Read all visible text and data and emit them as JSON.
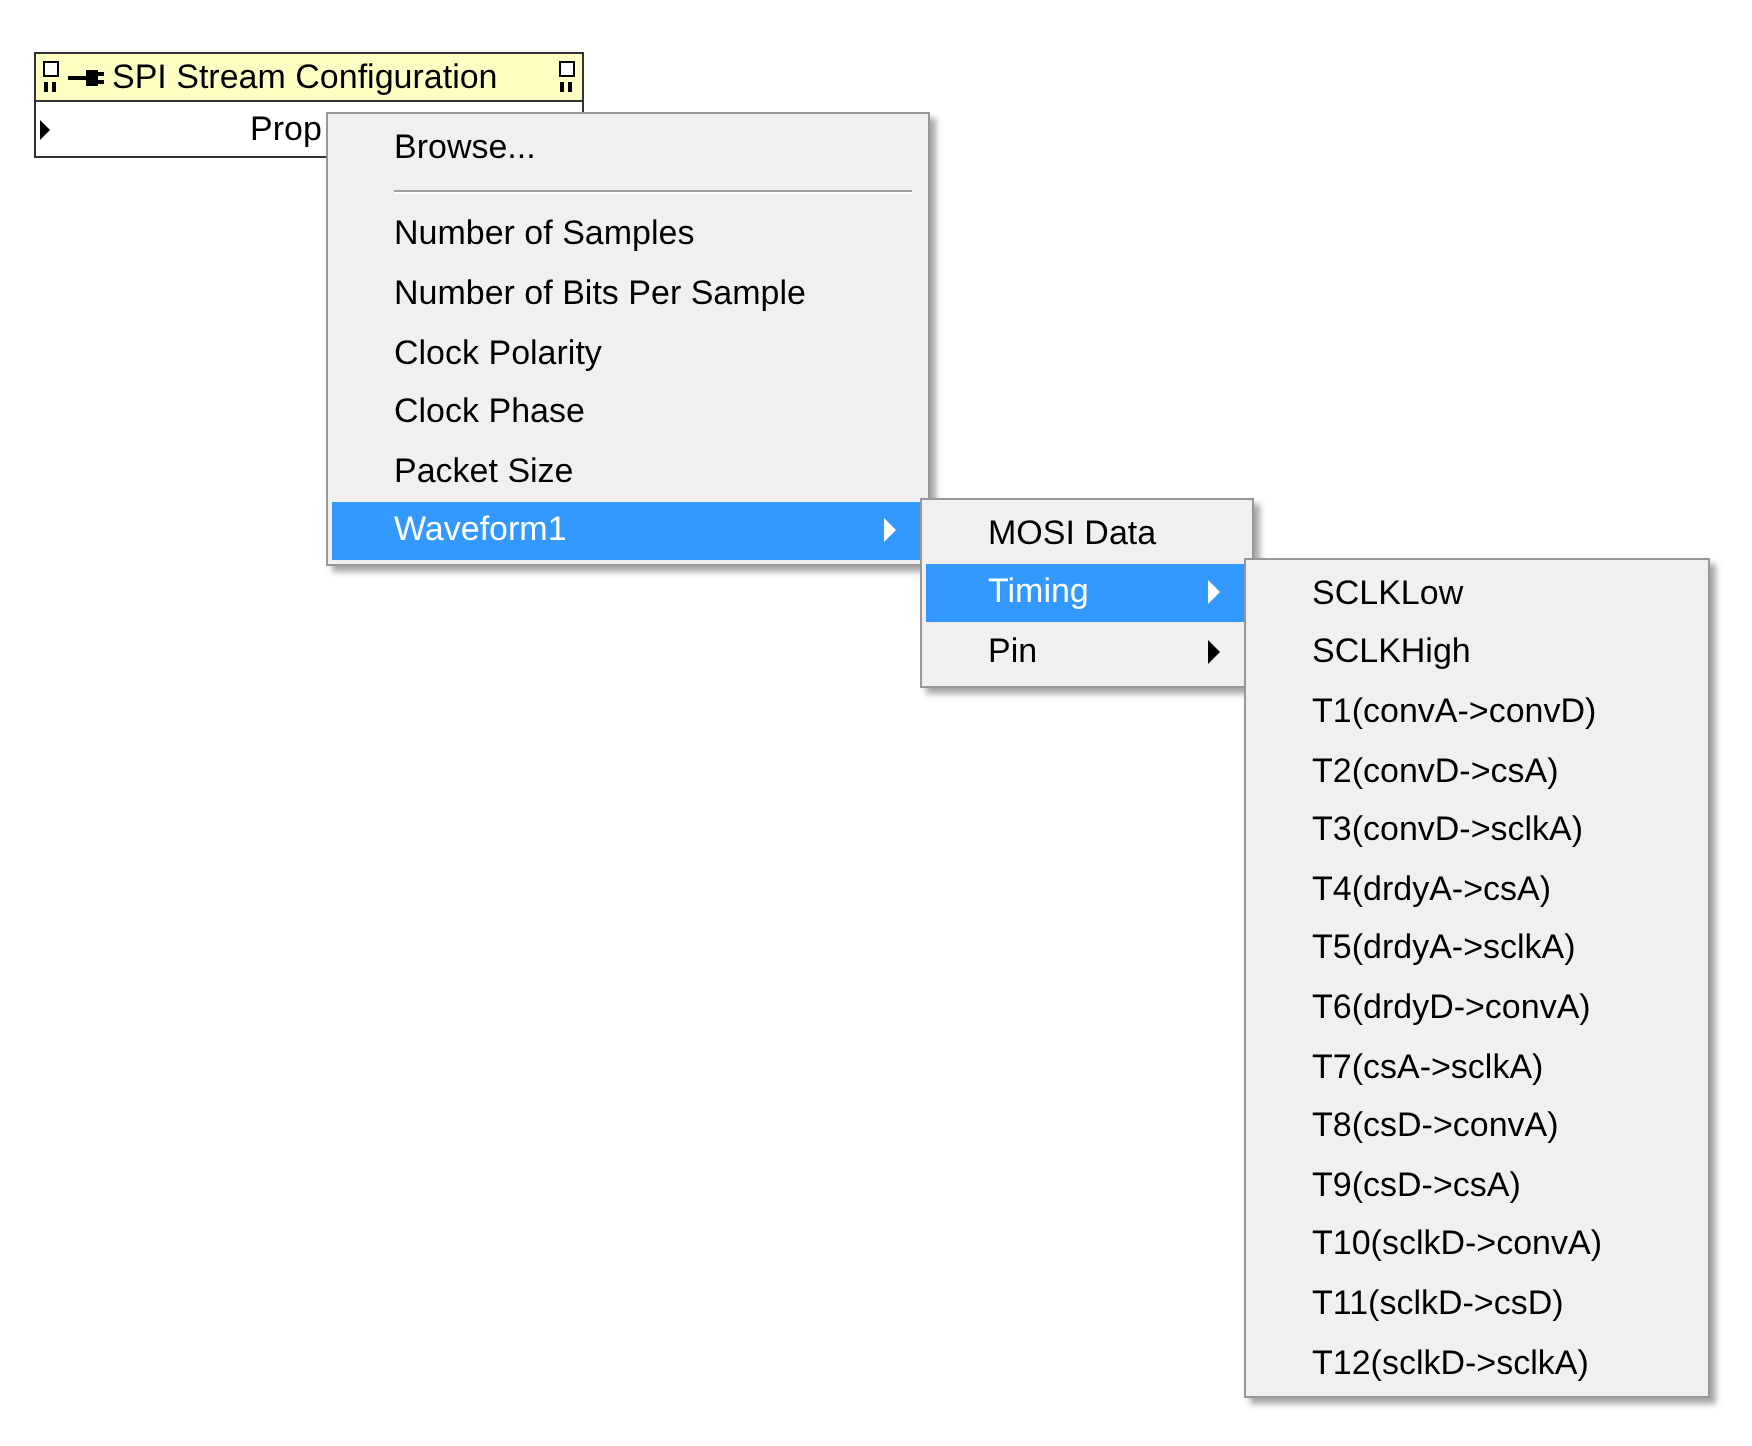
{
  "node": {
    "title": "SPI Stream Configuration",
    "property": "Prop"
  },
  "menus": [
    {
      "items": [
        {
          "label": "Browse...",
          "selected": false,
          "submenu": false,
          "separator_after": true
        },
        {
          "label": "Number of Samples",
          "selected": false,
          "submenu": false
        },
        {
          "label": "Number of Bits Per Sample",
          "selected": false,
          "submenu": false
        },
        {
          "label": "Clock Polarity",
          "selected": false,
          "submenu": false
        },
        {
          "label": "Clock Phase",
          "selected": false,
          "submenu": false
        },
        {
          "label": "Packet Size",
          "selected": false,
          "submenu": false
        },
        {
          "label": "Waveform1",
          "selected": true,
          "submenu": true
        }
      ]
    },
    {
      "items": [
        {
          "label": "MOSI Data",
          "selected": false,
          "submenu": false
        },
        {
          "label": "Timing",
          "selected": true,
          "submenu": true
        },
        {
          "label": "Pin",
          "selected": false,
          "submenu": true
        }
      ]
    },
    {
      "items": [
        {
          "label": "SCLKLow",
          "selected": false,
          "submenu": false
        },
        {
          "label": "SCLKHigh",
          "selected": false,
          "submenu": false
        },
        {
          "label": "T1(convA->convD)",
          "selected": false,
          "submenu": false
        },
        {
          "label": "T2(convD->csA)",
          "selected": false,
          "submenu": false
        },
        {
          "label": "T3(convD->sclkA)",
          "selected": false,
          "submenu": false
        },
        {
          "label": "T4(drdyA->csA)",
          "selected": false,
          "submenu": false
        },
        {
          "label": "T5(drdyA->sclkA)",
          "selected": false,
          "submenu": false
        },
        {
          "label": "T6(drdyD->convA)",
          "selected": false,
          "submenu": false
        },
        {
          "label": "T7(csA->sclkA)",
          "selected": false,
          "submenu": false
        },
        {
          "label": "T8(csD->convA)",
          "selected": false,
          "submenu": false
        },
        {
          "label": "T9(csD->csA)",
          "selected": false,
          "submenu": false
        },
        {
          "label": "T10(sclkD->convA)",
          "selected": false,
          "submenu": false
        },
        {
          "label": "T11(sclkD->csD)",
          "selected": false,
          "submenu": false
        },
        {
          "label": "T12(sclkD->sclkA)",
          "selected": false,
          "submenu": false
        }
      ]
    }
  ]
}
